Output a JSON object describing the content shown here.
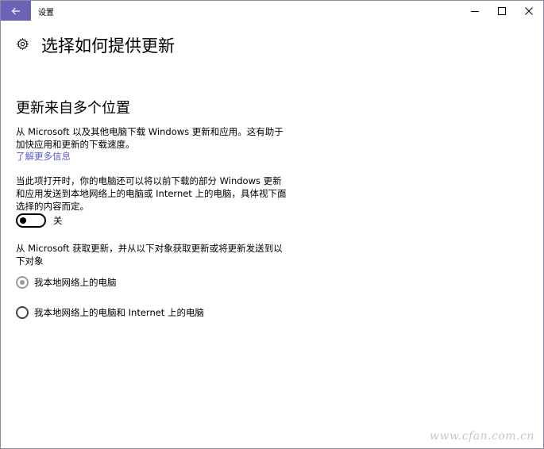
{
  "window": {
    "title": "设置"
  },
  "header": {
    "title": "选择如何提供更新",
    "icon": "gear-icon"
  },
  "section": {
    "heading": "更新来自多个位置",
    "description_line1": "从 Microsoft 以及其他电脑下载 Windows 更新和应用。这有助于",
    "description_line2": "加快应用和更新的下载速度。",
    "learn_more": "了解更多信息",
    "toggle_desc_line1": "当此项打开时，你的电脑还可以将以前下载的部分 Windows 更新",
    "toggle_desc_line2": "和应用发送到本地网络上的电脑或 Internet 上的电脑，具体视下面",
    "toggle_desc_line3": "选择的内容而定。",
    "toggle": {
      "state": "off",
      "label": "关"
    },
    "source_desc_line1": "从 Microsoft 获取更新，并从以下对象获取更新或将更新发送到以",
    "source_desc_line2": "下对象",
    "options": [
      {
        "label": "我本地网络上的电脑",
        "selected": true,
        "disabled": true
      },
      {
        "label": "我本地网络上的电脑和 Internet 上的电脑",
        "selected": false,
        "disabled": false
      }
    ]
  },
  "watermark": {
    "text": "www.cfan.com.cn"
  },
  "colors": {
    "accent": "#6b63b5",
    "link": "#5b5bc8"
  }
}
